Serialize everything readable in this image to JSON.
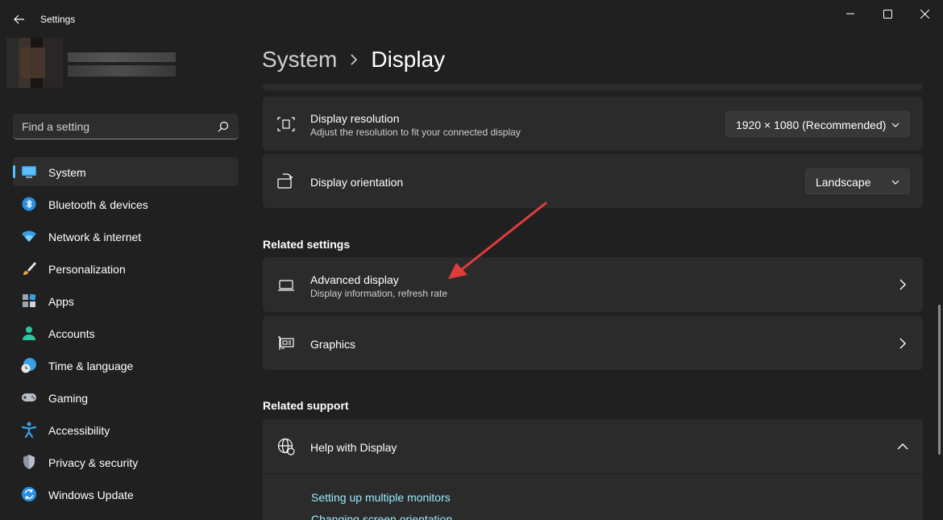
{
  "window": {
    "title": "Settings",
    "back_icon": "back-arrow-icon",
    "minimize_icon": "minimize-icon",
    "maximize_icon": "maximize-icon",
    "close_icon": "close-icon"
  },
  "search": {
    "placeholder": "Find a setting",
    "icon": "search-icon"
  },
  "sidebar": {
    "items": [
      {
        "label": "System",
        "icon": "monitor-icon",
        "active": true
      },
      {
        "label": "Bluetooth & devices",
        "icon": "bluetooth-icon"
      },
      {
        "label": "Network & internet",
        "icon": "wifi-icon"
      },
      {
        "label": "Personalization",
        "icon": "brush-icon"
      },
      {
        "label": "Apps",
        "icon": "apps-icon"
      },
      {
        "label": "Accounts",
        "icon": "person-icon"
      },
      {
        "label": "Time & language",
        "icon": "globe-clock-icon"
      },
      {
        "label": "Gaming",
        "icon": "gamepad-icon"
      },
      {
        "label": "Accessibility",
        "icon": "accessibility-icon"
      },
      {
        "label": "Privacy & security",
        "icon": "shield-icon"
      },
      {
        "label": "Windows Update",
        "icon": "update-icon"
      }
    ]
  },
  "breadcrumb": {
    "parent": "System",
    "current": "Display"
  },
  "settings": {
    "resolution": {
      "title": "Display resolution",
      "subtitle": "Adjust the resolution to fit your connected display",
      "value": "1920 × 1080 (Recommended)"
    },
    "orientation": {
      "title": "Display orientation",
      "value": "Landscape"
    }
  },
  "related_settings": {
    "heading": "Related settings",
    "advanced": {
      "title": "Advanced display",
      "subtitle": "Display information, refresh rate"
    },
    "graphics": {
      "title": "Graphics"
    }
  },
  "related_support": {
    "heading": "Related support",
    "help": {
      "title": "Help with Display"
    },
    "links": [
      "Setting up multiple monitors",
      "Changing screen orientation"
    ]
  },
  "colors": {
    "accent": "#4cc2ff",
    "annotation_arrow": "#e03c3c",
    "link": "#99ebff"
  }
}
